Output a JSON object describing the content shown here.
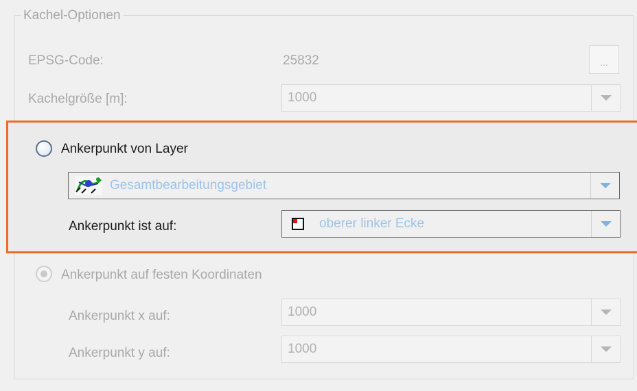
{
  "group": {
    "legend": "Kachel-Optionen"
  },
  "epsg": {
    "label": "EPSG-Code:",
    "value": "25832",
    "button_label": "..."
  },
  "tile_size": {
    "label": "Kachelgröße [m]:",
    "value": "1000"
  },
  "anchor_layer": {
    "radio_label": "Ankerpunkt von Layer",
    "layer_value": "Gesamtbearbeitungsgebiet",
    "position_label": "Ankerpunkt ist auf:",
    "position_value": "oberer linker Ecke",
    "layer_icon": "layer-icon",
    "position_icon": "top-left-corner-icon"
  },
  "anchor_fixed": {
    "radio_label": "Ankerpunkt auf festen Koordinaten",
    "x_label": "Ankerpunkt x auf:",
    "x_value": "1000",
    "y_label": "Ankerpunkt y auf:",
    "y_value": "1000"
  },
  "colors": {
    "highlight_border": "#ec6b26",
    "accent_arrow": "#7fb2e0",
    "active_value_text": "#9cc3ea",
    "disabled_text": "#a9a9a9"
  }
}
